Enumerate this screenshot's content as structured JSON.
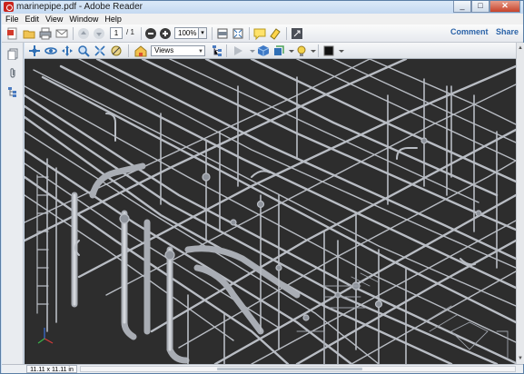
{
  "window": {
    "title": "marinepipe.pdf - Adobe Reader",
    "controls": [
      "minimize",
      "maximize",
      "close"
    ]
  },
  "menu": [
    "File",
    "Edit",
    "View",
    "Window",
    "Help"
  ],
  "toolbar": {
    "page_current": "1",
    "page_total": "/ 1",
    "zoom": "100%",
    "comment_label": "Comment",
    "share_label": "Share"
  },
  "viewer3d": {
    "views_select": "Views",
    "background": "#2d2d2d",
    "pipe_color": "#b9bdc4"
  },
  "status": {
    "page_size": "11.11 x 11.11 in"
  },
  "icons": {
    "sidebar": [
      "pages-panel-icon",
      "attachments-icon",
      "model-tree-icon"
    ]
  }
}
